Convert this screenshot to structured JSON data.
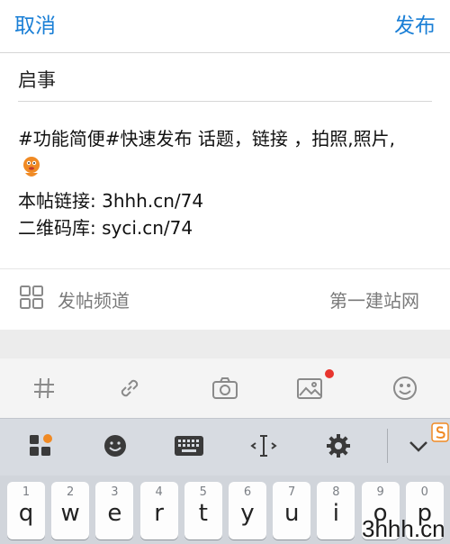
{
  "header": {
    "cancel_label": "取消",
    "publish_label": "发布"
  },
  "post": {
    "title": "启事",
    "lines": [
      "#功能简便#快速发布 话题，链接 ，拍照,照片,",
      "本帖链接: 3hhh.cn/74",
      "二维码库: syci.cn/74"
    ]
  },
  "channel": {
    "label": "发帖频道",
    "value": "第一建站网"
  },
  "toolbar": {
    "icons": [
      "hash-icon",
      "link-icon",
      "camera-icon",
      "image-icon",
      "emoji-icon"
    ]
  },
  "keyboard": {
    "bar_icons": [
      "apps-icon",
      "emoji-icon",
      "keyboard-icon",
      "cursor-icon",
      "gear-icon",
      "collapse-icon"
    ],
    "keys": [
      {
        "num": "1",
        "letter": "q"
      },
      {
        "num": "2",
        "letter": "w"
      },
      {
        "num": "3",
        "letter": "e"
      },
      {
        "num": "4",
        "letter": "r"
      },
      {
        "num": "5",
        "letter": "t"
      },
      {
        "num": "6",
        "letter": "y"
      },
      {
        "num": "7",
        "letter": "u"
      },
      {
        "num": "8",
        "letter": "i"
      },
      {
        "num": "9",
        "letter": "o"
      },
      {
        "num": "0",
        "letter": "p"
      }
    ]
  },
  "watermark": "3hhh.cn",
  "colors": {
    "accent": "#1a7fd6",
    "notify": "#e8352e",
    "sogou": "#f08a24"
  }
}
